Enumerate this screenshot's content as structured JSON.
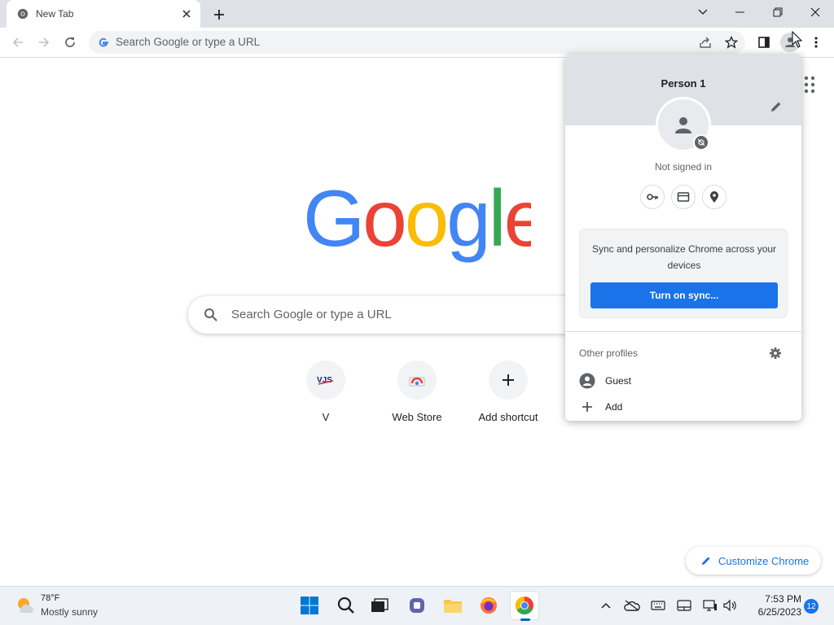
{
  "browser": {
    "tab_title": "New Tab",
    "omnibox_placeholder": "Search Google or type a URL"
  },
  "page": {
    "search_placeholder": "Search Google or type a URL",
    "shortcuts": [
      {
        "label": "V",
        "icon": "vjs-favicon"
      },
      {
        "label": "Web Store",
        "icon": "web-store-icon"
      },
      {
        "label": "Add shortcut",
        "icon": "plus-icon"
      }
    ],
    "customize_label": "Customize Chrome"
  },
  "profile_popup": {
    "name": "Person 1",
    "status": "Not signed in",
    "sync_promo": "Sync and personalize Chrome across your devices",
    "sync_button": "Turn on sync...",
    "other_profiles_label": "Other profiles",
    "guest_label": "Guest",
    "add_label": "Add"
  },
  "taskbar": {
    "weather_temp": "78°F",
    "weather_condition": "Mostly sunny",
    "time": "7:53 PM",
    "date": "6/25/2023",
    "notification_count": "12"
  },
  "colors": {
    "accent": "#1a73e8",
    "tabstrip": "#dee1e6",
    "google_blue": "#4285f4",
    "google_red": "#ea4335",
    "google_yellow": "#fbbc05",
    "google_green": "#34a853"
  }
}
